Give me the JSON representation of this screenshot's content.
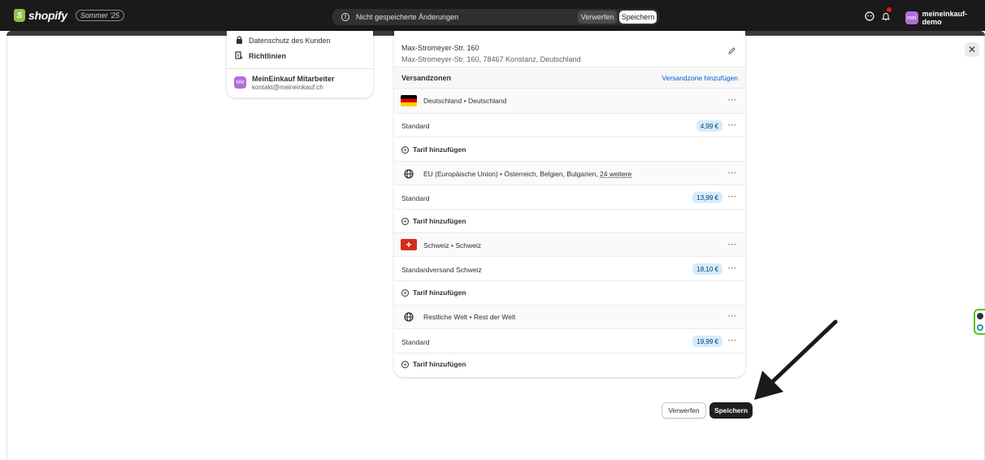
{
  "topbar": {
    "brand": "shopify",
    "edition": "Sommer '25",
    "unsaved_text": "Nicht gespeicherte Änderungen",
    "discard_label": "Verwerfen",
    "save_label": "Speichern",
    "store_initials": "mei",
    "store_name": "meineinkauf-demo"
  },
  "sidebar_card": {
    "items": [
      {
        "label": "Datenschutz des Kunden",
        "icon": "lock-icon"
      },
      {
        "label": "Richtlinien",
        "icon": "policy-icon"
      }
    ],
    "staff": {
      "initials": "MM",
      "name": "MeinEinkauf Mitarbeiter",
      "email": "kontakt@meineinkauf.ch"
    }
  },
  "main": {
    "address_line1": "Max-Stromeyer-Str. 160",
    "address_line2": "Max-Stromeyer-Str. 160, 78467 Konstanz, Deutschland",
    "zones_title": "Versandzonen",
    "zones_add": "Versandzone hinzufügen",
    "zones": [
      {
        "label": "Deutschland • Deutschland",
        "more": "",
        "flag": "de",
        "tariff_name": "Standard",
        "tariff_price": "4,99 €",
        "add_label": "Tarif hinzufügen"
      },
      {
        "label": "EU (Europäische Union) • Österreich, Belgien, Bulgarien, ",
        "more": "24 weitere",
        "flag": "globe",
        "tariff_name": "Standard",
        "tariff_price": "13,99 €",
        "add_label": "Tarif hinzufügen"
      },
      {
        "label": "Schweiz • Schweiz",
        "more": "",
        "flag": "ch",
        "tariff_name": "Standardversand Schweiz",
        "tariff_price": "18,10 €",
        "add_label": "Tarif hinzufügen"
      },
      {
        "label": "Restliche Welt • Rest der Welt",
        "more": "",
        "flag": "globe",
        "tariff_name": "Standard",
        "tariff_price": "19,99 €",
        "add_label": "Tarif hinzufügen"
      }
    ]
  },
  "footer": {
    "discard_label": "Verwerfen",
    "save_label": "Speichern"
  },
  "colors": {
    "topbar": "#1a1a1a",
    "accent_link": "#005bd3",
    "price_badge": "#d5ebff",
    "primary_button": "#1f1f1f",
    "brand_green": "#95bf47",
    "avatar_purple": "#b06fdd"
  }
}
